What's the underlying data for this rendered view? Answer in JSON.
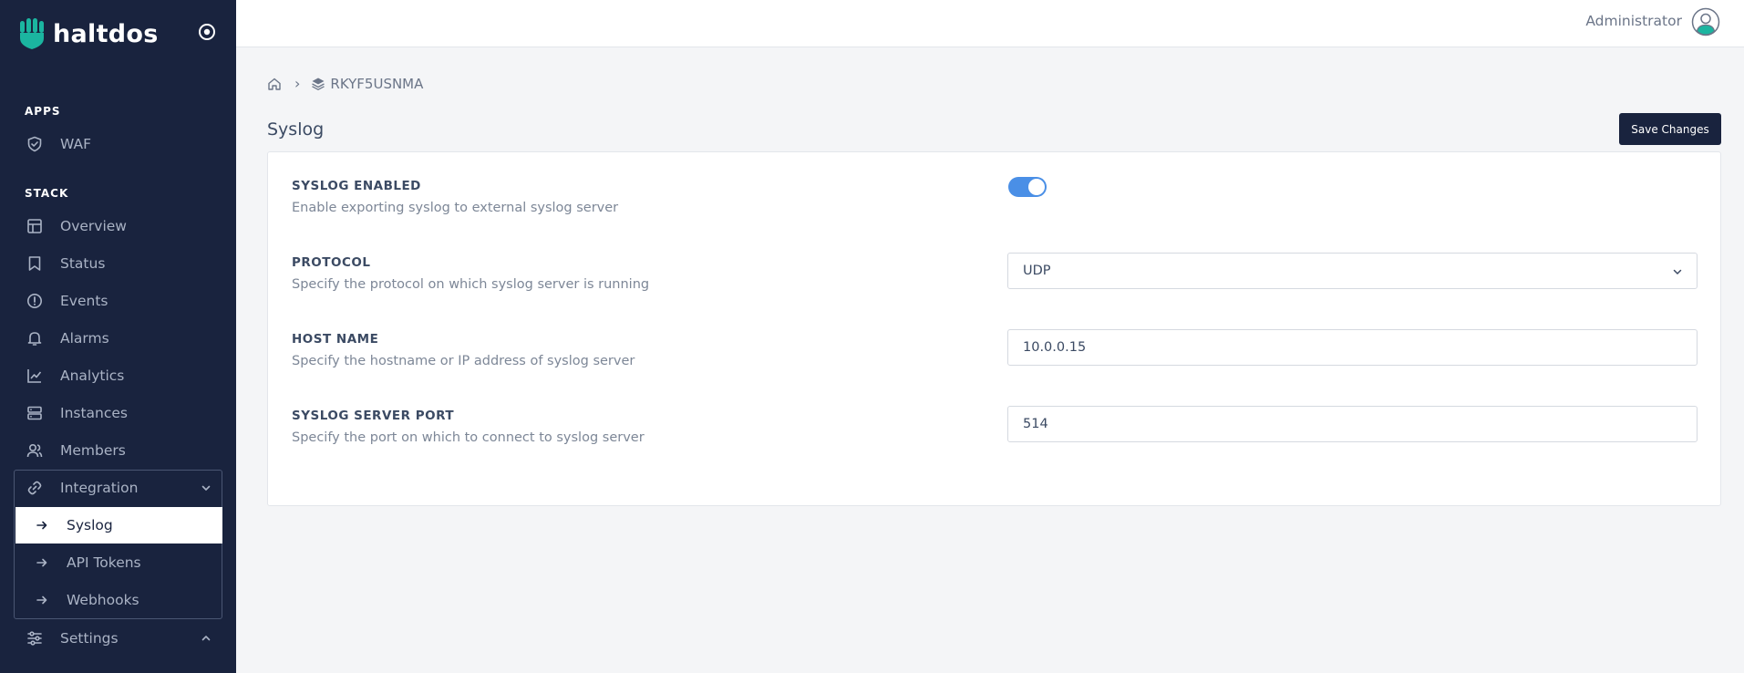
{
  "brand": {
    "name": "haltdos"
  },
  "sidebar": {
    "apps_title": "APPS",
    "apps": [
      {
        "label": "WAF",
        "icon": "shield-check-icon"
      }
    ],
    "stack_title": "STACK",
    "stack": [
      {
        "label": "Overview",
        "icon": "layout-icon"
      },
      {
        "label": "Status",
        "icon": "bookmark-icon"
      },
      {
        "label": "Events",
        "icon": "alert-circle-icon"
      },
      {
        "label": "Alarms",
        "icon": "bell-icon"
      },
      {
        "label": "Analytics",
        "icon": "chart-line-icon"
      },
      {
        "label": "Instances",
        "icon": "server-icon"
      },
      {
        "label": "Members",
        "icon": "users-icon"
      }
    ],
    "integration": {
      "label": "Integration",
      "icon": "link-icon",
      "items": [
        {
          "label": "Syslog",
          "active": true
        },
        {
          "label": "API Tokens",
          "active": false
        },
        {
          "label": "Webhooks",
          "active": false
        }
      ]
    },
    "settings": {
      "label": "Settings",
      "icon": "sliders-icon"
    }
  },
  "topbar": {
    "user": "Administrator"
  },
  "breadcrumb": {
    "stack_id": "RKYF5USNMA"
  },
  "page": {
    "title": "Syslog",
    "save_label": "Save Changes"
  },
  "form": {
    "enabled": {
      "label": "SYSLOG ENABLED",
      "desc": "Enable exporting syslog to external syslog server",
      "value": true
    },
    "protocol": {
      "label": "PROTOCOL",
      "desc": "Specify the protocol on which syslog server is running",
      "value": "UDP"
    },
    "host": {
      "label": "HOST NAME",
      "desc": "Specify the hostname or IP address of syslog server",
      "value": "10.0.0.15"
    },
    "port": {
      "label": "SYSLOG SERVER PORT",
      "desc": "Specify the port on which to connect to syslog server",
      "value": "514"
    }
  },
  "colors": {
    "sidebar": "#19233e",
    "accent": "#4a8fe6",
    "brand_teal": "#1bb5a0"
  }
}
